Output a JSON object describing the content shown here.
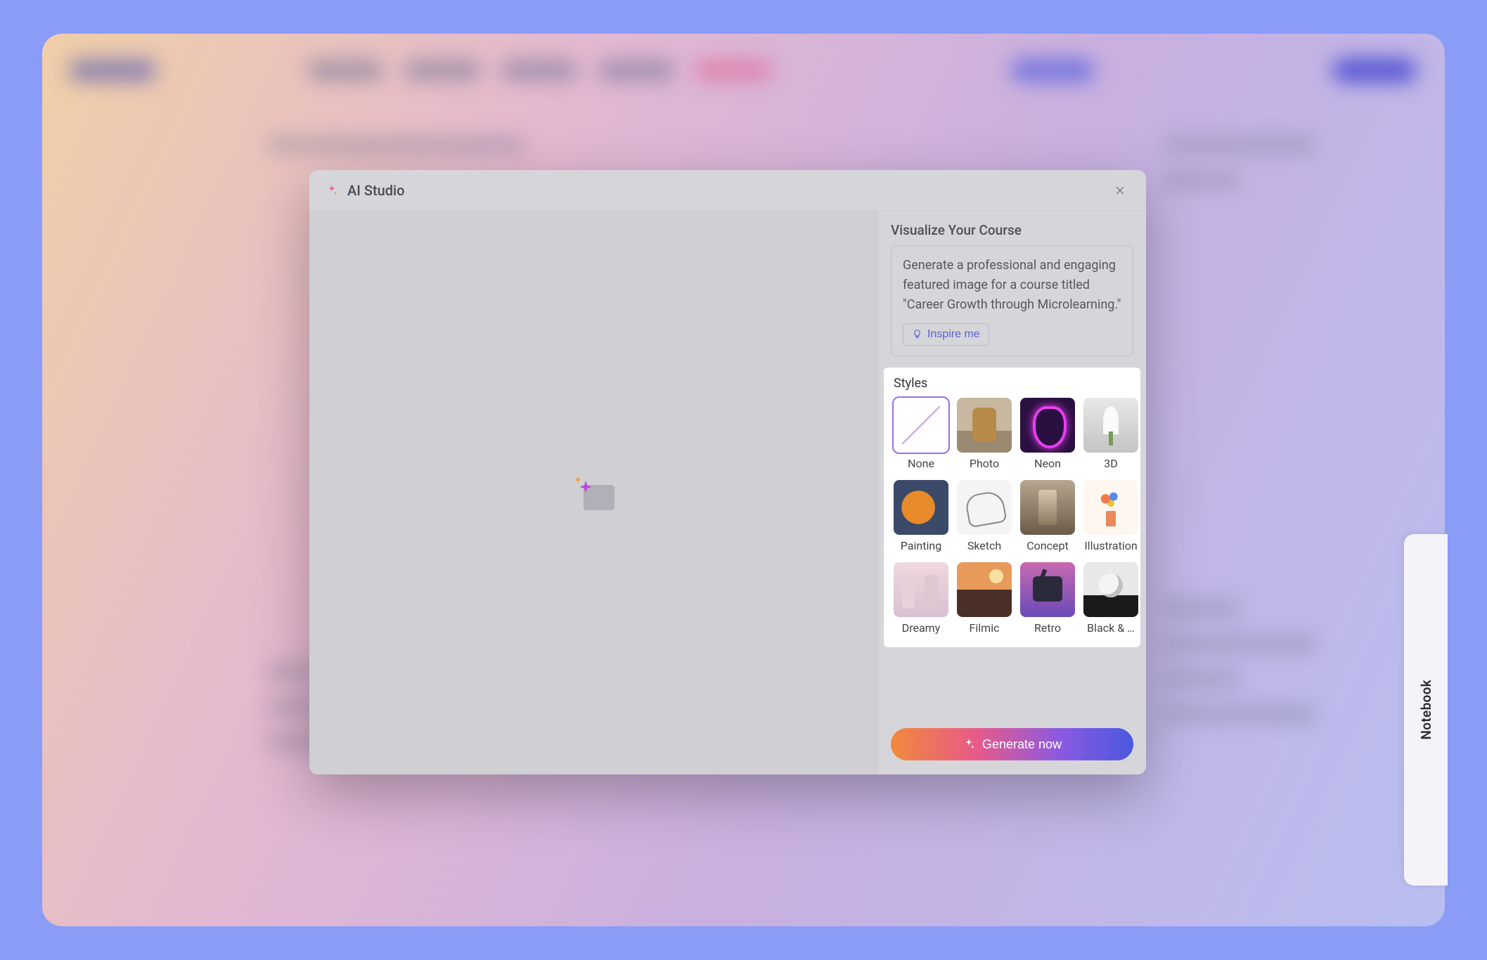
{
  "modal": {
    "title": "AI Studio",
    "sidebar": {
      "section_title": "Visualize Your Course",
      "prompt": "Generate a professional and engaging featured image for a course titled \"Career Growth through Microlearning.\"",
      "inspire_label": "Inspire me",
      "styles_title": "Styles",
      "styles": [
        {
          "id": "none",
          "label": "None",
          "selected": true
        },
        {
          "id": "photo",
          "label": "Photo",
          "selected": false
        },
        {
          "id": "neon",
          "label": "Neon",
          "selected": false
        },
        {
          "id": "3d",
          "label": "3D",
          "selected": false
        },
        {
          "id": "painting",
          "label": "Painting",
          "selected": false
        },
        {
          "id": "sketch",
          "label": "Sketch",
          "selected": false
        },
        {
          "id": "concept",
          "label": "Concept",
          "selected": false
        },
        {
          "id": "illustration",
          "label": "Illustration",
          "selected": false
        },
        {
          "id": "dreamy",
          "label": "Dreamy",
          "selected": false
        },
        {
          "id": "filmic",
          "label": "Filmic",
          "selected": false
        },
        {
          "id": "retro",
          "label": "Retro",
          "selected": false
        },
        {
          "id": "bw",
          "label": "Black & …",
          "selected": false
        }
      ],
      "generate_label": "Generate now"
    }
  },
  "notebook_tab": "Notebook"
}
